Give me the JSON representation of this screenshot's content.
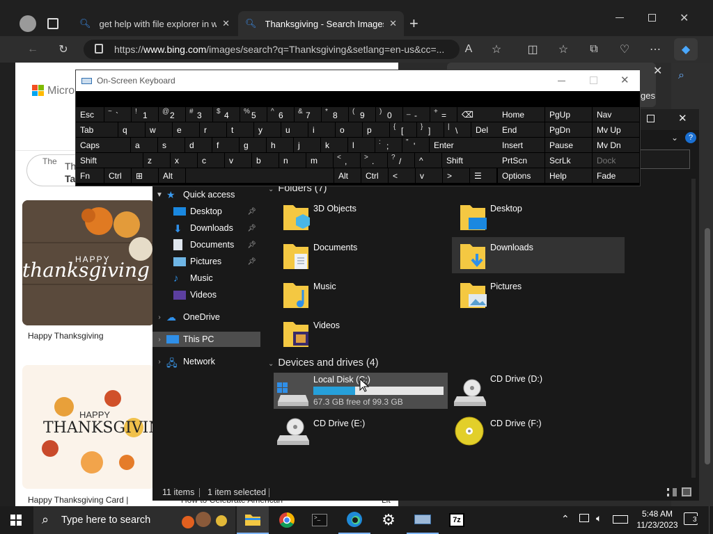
{
  "browser": {
    "tabs": [
      {
        "title": "get help with file explorer in win"
      },
      {
        "title": "Thanksgiving - Search Images"
      }
    ],
    "url_prefix": "https://",
    "url_domain": "www.bing.com",
    "url_rest": "/images/search?q=Thanksgiving&setlang=en-us&cc=...",
    "read_aloud_label": "A",
    "page": {
      "logo_text": "Micro",
      "truncated_tab_text": "The",
      "truncated_tab_text2": "Th",
      "truncated_tab_text3": "Ta",
      "card1_art_top": "HAPPY",
      "card1_art_main": "thanksgiving",
      "card1_caption": "Happy Thanksgiving",
      "card2_art_top": "HAPPY",
      "card2_art_main": "THANKSGIVING",
      "card2_caption": "Happy Thanksgiving Card |",
      "card3_caption": "How to Celebrate American",
      "card4_caption": "Lit"
    },
    "side_panel_text": "ges"
  },
  "osk": {
    "title": "On-Screen Keyboard",
    "rows": [
      [
        {
          "label": "Esc"
        },
        {
          "s": "~",
          "b": "`"
        },
        {
          "s": "!",
          "b": "1"
        },
        {
          "s": "@",
          "b": "2"
        },
        {
          "s": "#",
          "b": "3"
        },
        {
          "s": "$",
          "b": "4"
        },
        {
          "s": "%",
          "b": "5"
        },
        {
          "s": "^",
          "b": "6"
        },
        {
          "s": "&",
          "b": "7"
        },
        {
          "s": "*",
          "b": "8"
        },
        {
          "s": "(",
          "b": "9"
        },
        {
          "s": ")",
          "b": "0"
        },
        {
          "s": "_",
          "b": "-"
        },
        {
          "s": "+",
          "b": "="
        },
        {
          "label": "⌫"
        }
      ],
      [
        {
          "label": "Tab"
        },
        {
          "label": "q"
        },
        {
          "label": "w"
        },
        {
          "label": "e"
        },
        {
          "label": "r"
        },
        {
          "label": "t"
        },
        {
          "label": "y"
        },
        {
          "label": "u"
        },
        {
          "label": "i"
        },
        {
          "label": "o"
        },
        {
          "label": "p"
        },
        {
          "s": "{",
          "b": "["
        },
        {
          "s": "}",
          "b": "]"
        },
        {
          "s": "|",
          "b": "\\"
        },
        {
          "label": "Del"
        }
      ],
      [
        {
          "label": "Caps"
        },
        {
          "label": "a"
        },
        {
          "label": "s"
        },
        {
          "label": "d"
        },
        {
          "label": "f"
        },
        {
          "label": "g"
        },
        {
          "label": "h"
        },
        {
          "label": "j"
        },
        {
          "label": "k"
        },
        {
          "label": "l"
        },
        {
          "s": ":",
          "b": ";"
        },
        {
          "s": "\"",
          "b": "'"
        },
        {
          "label": "Enter"
        }
      ],
      [
        {
          "label": "Shift"
        },
        {
          "label": "z"
        },
        {
          "label": "x"
        },
        {
          "label": "c"
        },
        {
          "label": "v"
        },
        {
          "label": "b"
        },
        {
          "label": "n"
        },
        {
          "label": "m"
        },
        {
          "s": "<",
          "b": ","
        },
        {
          "s": ">",
          "b": "."
        },
        {
          "s": "?",
          "b": "/"
        },
        {
          "label": "^"
        },
        {
          "label": "Shift"
        }
      ],
      [
        {
          "label": "Fn"
        },
        {
          "label": "Ctrl"
        },
        {
          "label": "⊞"
        },
        {
          "label": "Alt"
        },
        {
          "label": ""
        },
        {
          "label": "Alt"
        },
        {
          "label": "Ctrl"
        },
        {
          "label": "<"
        },
        {
          "label": "v"
        },
        {
          "label": ">"
        },
        {
          "label": "☰"
        }
      ]
    ],
    "nav_keys": [
      [
        "Home",
        "PgUp",
        "Nav"
      ],
      [
        "End",
        "PgDn",
        "Mv Up"
      ],
      [
        "Insert",
        "Pause",
        "Mv Dn"
      ],
      [
        "PrtScn",
        "ScrLk",
        "Dock"
      ],
      [
        "Options",
        "Help",
        "Fade"
      ]
    ]
  },
  "explorer": {
    "nav": [
      {
        "label": "Quick access",
        "pinned": false
      },
      {
        "label": "Desktop",
        "pinned": true
      },
      {
        "label": "Downloads",
        "pinned": true
      },
      {
        "label": "Documents",
        "pinned": true
      },
      {
        "label": "Pictures",
        "pinned": true
      },
      {
        "label": "Music",
        "pinned": false
      },
      {
        "label": "Videos",
        "pinned": false
      },
      {
        "label": "OneDrive",
        "pinned": false
      },
      {
        "label": "This PC",
        "pinned": false
      },
      {
        "label": "Network",
        "pinned": false
      }
    ],
    "folders_header": "Folders (7)",
    "folders": [
      "3D Objects",
      "Desktop",
      "Documents",
      "Downloads",
      "Music",
      "Pictures",
      "Videos"
    ],
    "drives_header": "Devices and drives (4)",
    "drives": [
      {
        "name": "Local Disk (C:)",
        "free": "67.3 GB free of 99.3 GB",
        "used_fraction": 0.32
      },
      {
        "name": "CD Drive (D:)"
      },
      {
        "name": "CD Drive (E:)"
      },
      {
        "name": "CD Drive (F:)"
      }
    ],
    "status_items": "11 items",
    "status_selected": "1 item selected"
  },
  "taskbar": {
    "search_placeholder": "Type here to search",
    "time": "5:48 AM",
    "date": "11/23/2023",
    "notification_count": "3"
  },
  "colors": {
    "accent": "#0078d7",
    "drive_bar": "#26a0da",
    "folder": "#f4c842"
  }
}
